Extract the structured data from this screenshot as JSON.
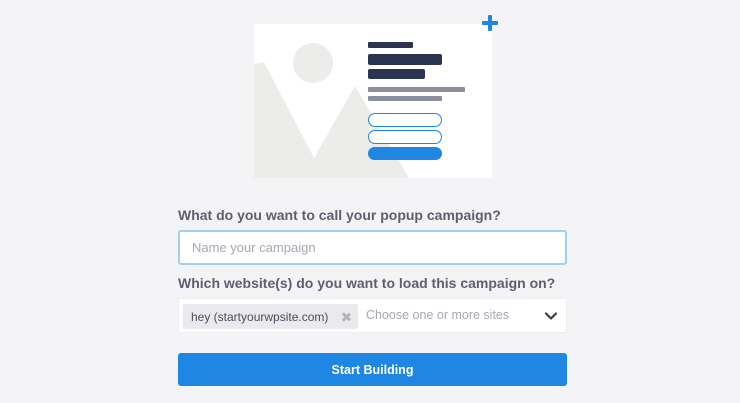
{
  "colors": {
    "accent": "#1f86e3",
    "input_focus_border": "#9fd0f3",
    "label_text": "#5c5f6e",
    "page_bg": "#f4f4f6"
  },
  "illustration": {
    "icon": "popup-template-illustration",
    "add_icon": "plus-icon"
  },
  "form": {
    "name_question": "What do you want to call your popup campaign?",
    "name_placeholder": "Name your campaign",
    "name_value": "",
    "website_question": "Which website(s) do you want to load this campaign on?",
    "selected_site": "hey (startyourwpsite.com)",
    "site_placeholder": "Choose one or more sites",
    "submit_label": "Start Building"
  }
}
